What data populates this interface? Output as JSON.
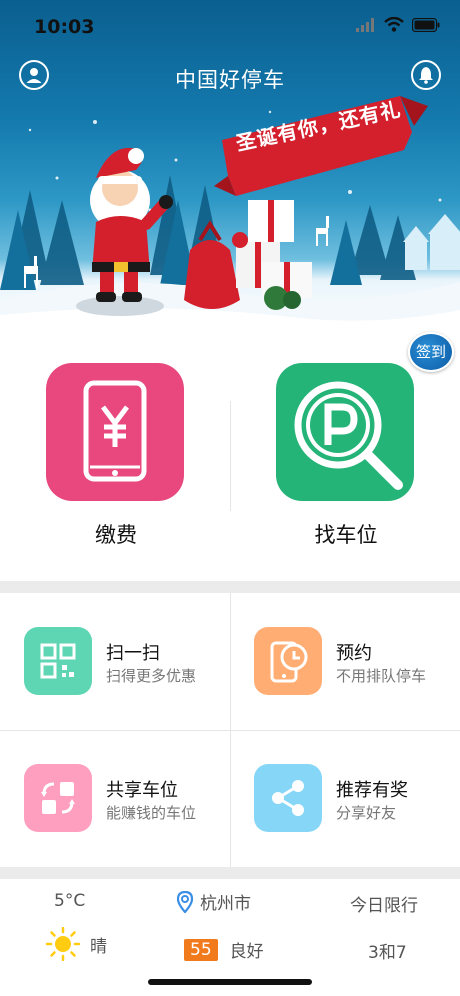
{
  "status_bar": {
    "time": "10:03"
  },
  "header": {
    "title": "中国好停车"
  },
  "banner": {
    "ribbon_text": "圣诞有你，还有礼"
  },
  "checkin": {
    "label": "签到"
  },
  "main_actions": [
    {
      "label": "缴费",
      "icon": "phone-yuan-icon"
    },
    {
      "label": "找车位",
      "icon": "parking-search-icon"
    }
  ],
  "services": [
    {
      "title": "扫一扫",
      "subtitle": "扫得更多优惠",
      "icon": "qr-scan-icon",
      "color": "#5fd6b3"
    },
    {
      "title": "预约",
      "subtitle": "不用排队停车",
      "icon": "phone-clock-icon",
      "color": "#ffad73"
    },
    {
      "title": "共享车位",
      "subtitle": "能赚钱的车位",
      "icon": "share-swap-icon",
      "color": "#ff9fc0"
    },
    {
      "title": "推荐有奖",
      "subtitle": "分享好友",
      "icon": "share-icon",
      "color": "#86d6f8"
    }
  ],
  "weather": {
    "temperature": "5°C",
    "condition": "晴",
    "city": "杭州市",
    "aqi_value": "55",
    "aqi_label": "良好",
    "restriction_title": "今日限行",
    "restriction_value": "3和7"
  },
  "colors": {
    "pay_tile": "#e9487e",
    "find_tile": "#24b478",
    "aqi_badge": "#f07a1c"
  }
}
